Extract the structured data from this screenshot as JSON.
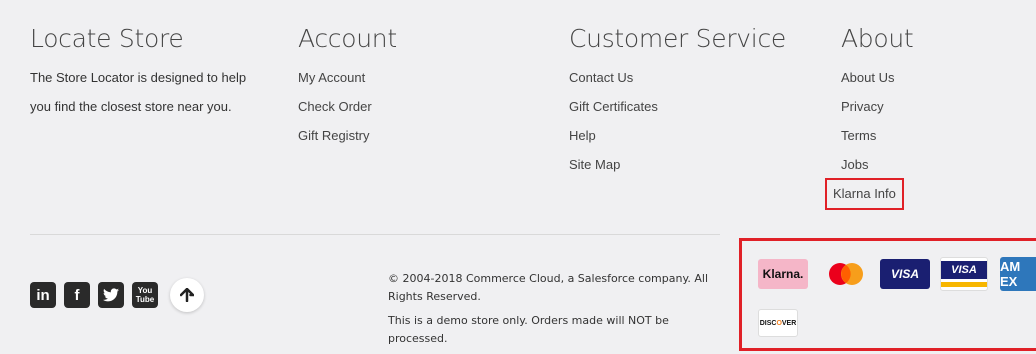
{
  "locate": {
    "title": "Locate Store",
    "text": "The Store Locator is designed to help you find the closest store near you."
  },
  "account": {
    "title": "Account",
    "links": [
      "My Account",
      "Check Order",
      "Gift Registry"
    ]
  },
  "service": {
    "title": "Customer Service",
    "links": [
      "Contact Us",
      "Gift Certificates",
      "Help",
      "Site Map"
    ]
  },
  "about": {
    "title": "About",
    "links": [
      "About Us",
      "Privacy",
      "Terms",
      "Jobs",
      "Klarna Info"
    ]
  },
  "social": {
    "icons": [
      "linkedin-icon",
      "facebook-icon",
      "twitter-icon",
      "youtube-icon"
    ],
    "linkedin": "in",
    "facebook": "f",
    "youtube_top": "You",
    "youtube_bottom": "Tube"
  },
  "copyright": "© 2004-2018 Commerce Cloud, a Salesforce company. All Rights Reserved.",
  "demo_notice": "This is a demo store only. Orders made will NOT be processed.",
  "payments": {
    "klarna": "Klarna.",
    "visa": "VISA",
    "visa_electron": "VISA",
    "amex": "AM EX",
    "discover_pre": "DISC",
    "discover_o": "O",
    "discover_post": "VER"
  },
  "colors": {
    "highlight": "#e02027",
    "background": "#f0f0f2",
    "visa_blue": "#1a1f71",
    "amex_blue": "#2e77bb",
    "klarna_pink": "#f5b6c8"
  }
}
